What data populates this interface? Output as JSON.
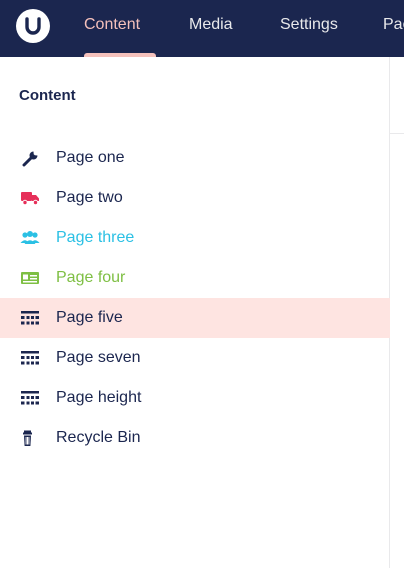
{
  "topbar": {
    "logo_icon": "umbraco-logo-icon",
    "sections": [
      {
        "label": "Content",
        "active": true
      },
      {
        "label": "Media",
        "active": false
      },
      {
        "label": "Settings",
        "active": false
      },
      {
        "label": "Pac",
        "active": false
      }
    ]
  },
  "tree": {
    "heading": "Content",
    "items": [
      {
        "label": "Page one",
        "icon": "wrench-icon",
        "color": "#1b264f",
        "selected": false
      },
      {
        "label": "Page two",
        "icon": "truck-icon",
        "color": "#e6305a",
        "selected": false
      },
      {
        "label": "Page three",
        "icon": "users-icon",
        "color": "#2bc0e4",
        "selected": false
      },
      {
        "label": "Page four",
        "icon": "id-card-icon",
        "color": "#7ebf43",
        "selected": false
      },
      {
        "label": "Page five",
        "icon": "grid-icon",
        "color": "#1b264f",
        "selected": true
      },
      {
        "label": "Page seven",
        "icon": "grid-icon",
        "color": "#1b264f",
        "selected": false
      },
      {
        "label": "Page height",
        "icon": "grid-icon",
        "color": "#1b264f",
        "selected": false
      },
      {
        "label": "Recycle Bin",
        "icon": "trash-icon",
        "color": "#1b264f",
        "selected": false
      }
    ]
  },
  "colors": {
    "topbar_bg": "#1b264f",
    "active_section": "#f5c1bc",
    "selected_row_bg": "#fee4e1",
    "text": "#1b264f"
  }
}
